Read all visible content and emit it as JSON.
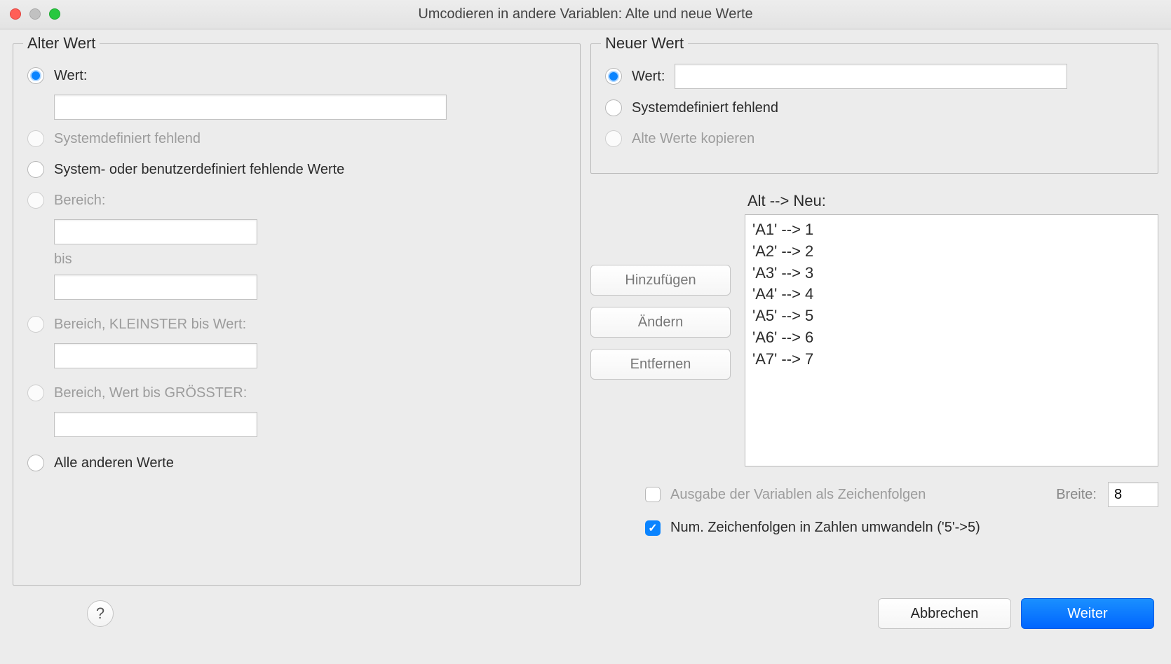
{
  "window": {
    "title": "Umcodieren in andere Variablen: Alte und neue Werte"
  },
  "old": {
    "legend": "Alter Wert",
    "opt_value": "Wert:",
    "opt_sysmiss": "Systemdefiniert fehlend",
    "opt_sys_or_user": "System- oder benutzerdefiniert fehlende Werte",
    "opt_range": "Bereich:",
    "range_bis": "bis",
    "opt_range_min": "Bereich, KLEINSTER bis Wert:",
    "opt_range_max": "Bereich, Wert bis GRÖSSTER:",
    "opt_all_other": "Alle anderen Werte"
  },
  "new": {
    "legend": "Neuer Wert",
    "opt_value": "Wert:",
    "opt_sysmiss": "Systemdefiniert fehlend",
    "opt_copy": "Alte Werte kopieren"
  },
  "map": {
    "header": "Alt --> Neu:",
    "btn_add": "Hinzufügen",
    "btn_change": "Ändern",
    "btn_remove": "Entfernen",
    "items": [
      "'A1' --> 1",
      "'A2' --> 2",
      "'A3' --> 3",
      "'A4' --> 4",
      "'A5' --> 5",
      "'A6' --> 6",
      "'A7' --> 7"
    ]
  },
  "options": {
    "chk_output_string": "Ausgabe der Variablen als Zeichenfolgen",
    "width_label": "Breite:",
    "width_value": "8",
    "chk_convert_num": "Num. Zeichenfolgen in Zahlen umwandeln ('5'->5)"
  },
  "footer": {
    "help": "?",
    "cancel": "Abbrechen",
    "continue": "Weiter"
  }
}
